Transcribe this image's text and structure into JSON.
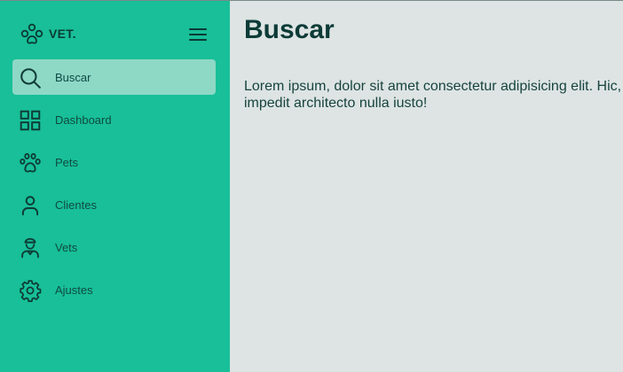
{
  "brand": {
    "logo_icon": "paw-pills-icon",
    "name": "VET."
  },
  "menu": {
    "icon": "hamburger-menu-icon"
  },
  "sidebar": {
    "items": [
      {
        "label": "Buscar",
        "icon": "search-icon",
        "active": true
      },
      {
        "label": "Dashboard",
        "icon": "grid-icon",
        "active": false
      },
      {
        "label": "Pets",
        "icon": "paw-icon",
        "active": false
      },
      {
        "label": "Clientes",
        "icon": "user-icon",
        "active": false
      },
      {
        "label": "Vets",
        "icon": "vet-doctor-icon",
        "active": false
      },
      {
        "label": "Ajustes",
        "icon": "gear-icon",
        "active": false
      }
    ]
  },
  "main": {
    "title": "Buscar",
    "text": "Lorem ipsum, dolor sit amet consectetur adipisicing elit. Hic, Eos omnis quia impedit architecto nulla iusto!"
  },
  "colors": {
    "sidebar_bg": "#18bf98",
    "active_item_bg": "#8ed8c6",
    "main_bg": "#dde4e3",
    "text_dark": "#0d3b37"
  }
}
